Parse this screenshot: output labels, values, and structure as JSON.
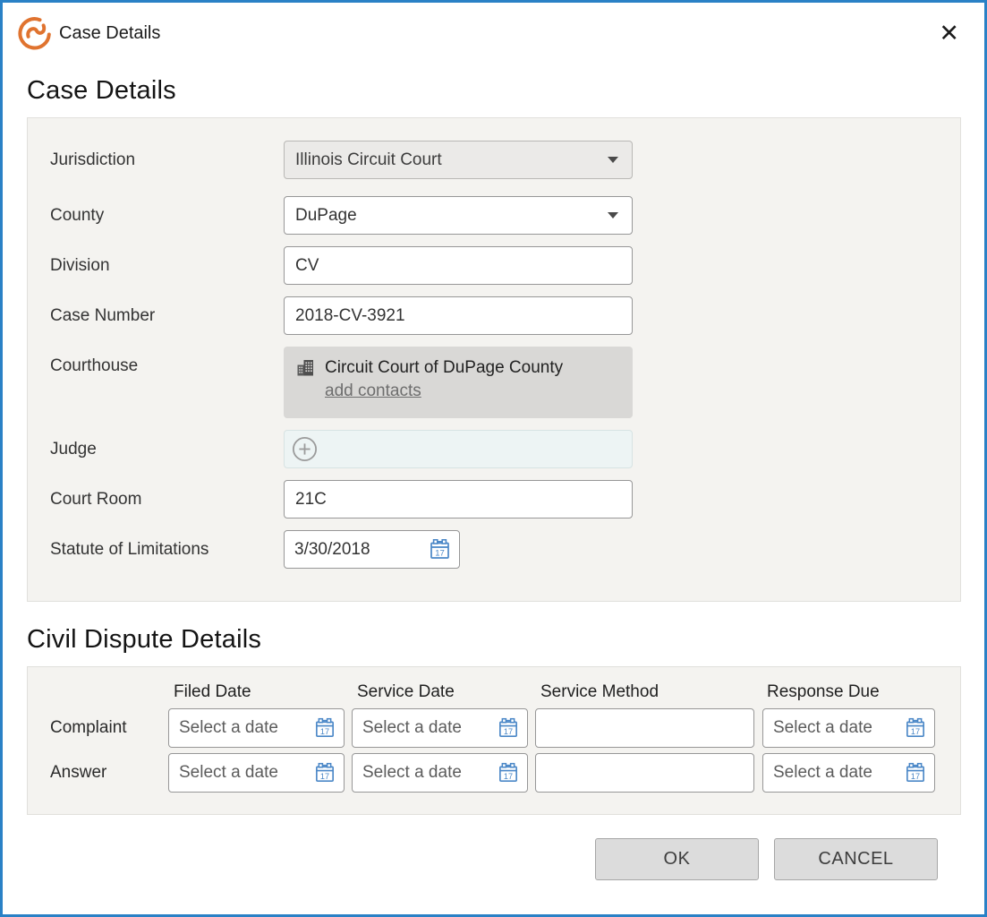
{
  "window": {
    "title": "Case Details",
    "close_glyph": "✕"
  },
  "case_details": {
    "heading": "Case Details",
    "fields": {
      "jurisdiction": {
        "label": "Jurisdiction",
        "value": "Illinois Circuit Court",
        "disabled": true
      },
      "county": {
        "label": "County",
        "value": "DuPage"
      },
      "division": {
        "label": "Division",
        "value": "CV"
      },
      "case_number": {
        "label": "Case Number",
        "value": "2018-CV-3921"
      },
      "courthouse": {
        "label": "Courthouse",
        "value": "Circuit Court of DuPage County",
        "link": "add contacts"
      },
      "judge": {
        "label": "Judge",
        "value": ""
      },
      "court_room": {
        "label": "Court Room",
        "value": "21C"
      },
      "statute_of_limitations": {
        "label": "Statute of Limitations",
        "value": "3/30/2018"
      }
    }
  },
  "civil_dispute": {
    "heading": "Civil Dispute Details",
    "columns": [
      "Filed Date",
      "Service Date",
      "Service Method",
      "Response Due"
    ],
    "rows": [
      {
        "label": "Complaint",
        "filed_date": "Select a date",
        "service_date": "Select a date",
        "service_method": "",
        "response_due": "Select a date"
      },
      {
        "label": "Answer",
        "filed_date": "Select a date",
        "service_date": "Select a date",
        "service_method": "",
        "response_due": "Select a date"
      }
    ]
  },
  "footer": {
    "ok_label": "OK",
    "cancel_label": "CANCEL"
  },
  "icons": {
    "calendar_day": "17",
    "logo": "smokeball-logo",
    "building": "courthouse-building-icon",
    "plus_circle": "add-judge-icon",
    "chevron": "chevron-down-icon"
  },
  "colors": {
    "window_border": "#2a81c6",
    "brand_orange": "#e0732f",
    "calendar_blue": "#4a87c7",
    "panel_bg": "#f4f3f0",
    "contact_box_bg": "#d9d8d6",
    "disabled_field_bg": "#ebeae8",
    "judge_field_bg": "#edf4f4",
    "button_bg": "#dcdcdc"
  }
}
